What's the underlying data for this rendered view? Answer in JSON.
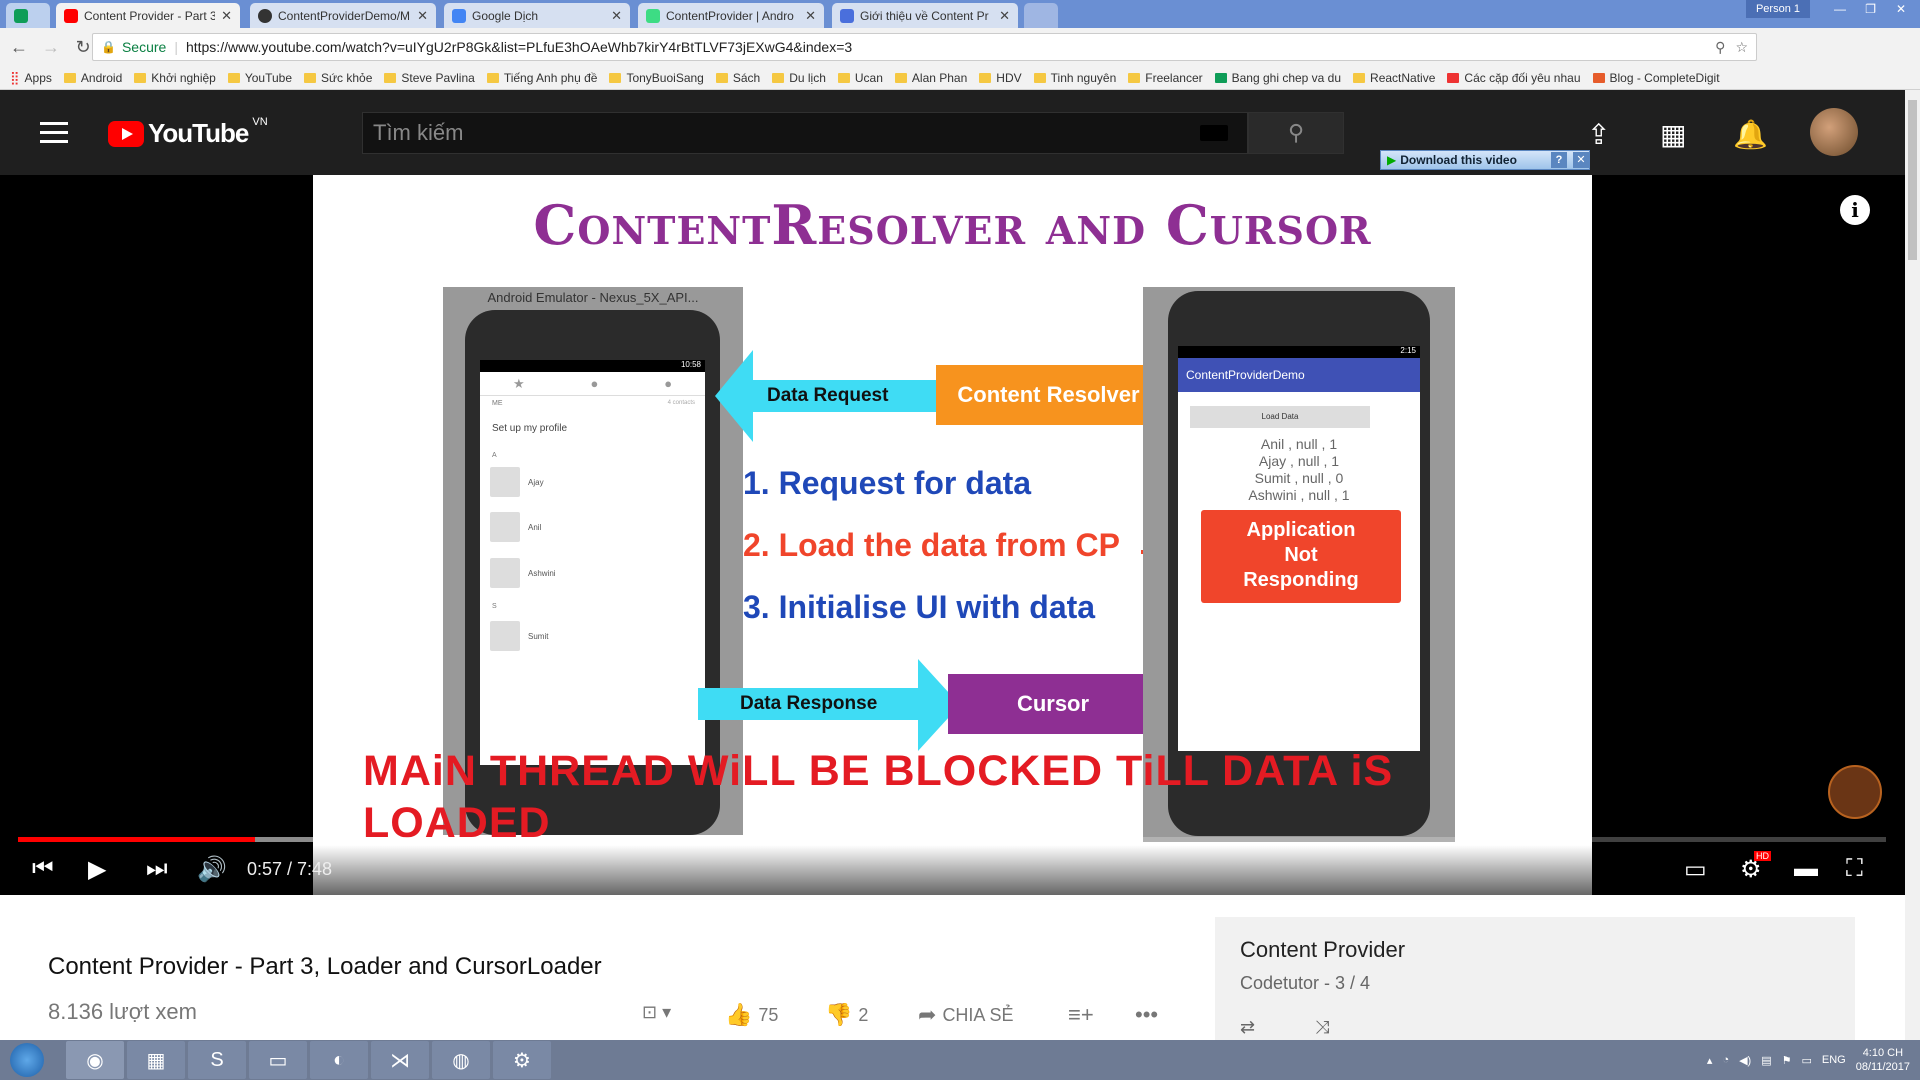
{
  "browser": {
    "tabs": [
      {
        "title": "Content Provider - Part 3",
        "active": true,
        "color": "#ff0000"
      },
      {
        "title": "ContentProviderDemo/M",
        "active": false,
        "color": "#333333"
      },
      {
        "title": "Google Dịch",
        "active": false,
        "color": "#4285f4"
      },
      {
        "title": "ContentProvider | Andro",
        "active": false,
        "color": "#3ddc84"
      },
      {
        "title": "Giới thiệu về Content Pr",
        "active": false,
        "color": "#4a6fdc"
      }
    ],
    "person": "Person 1",
    "secure_label": "Secure",
    "url": "https://www.youtube.com/watch?v=uIYgU2rP8Gk&list=PLfuE3hOAeWhb7kirY4rBtTLVF73jEXwG4&index=3",
    "bookmarks": [
      "Apps",
      "Android",
      "Khởi nghiệp",
      "YouTube",
      "Sức khỏe",
      "Steve Pavlina",
      "Tiếng Anh phụ đề",
      "TonyBuoiSang",
      "Sách",
      "Du lịch",
      "Ucan",
      "Alan Phan",
      "HDV",
      "Tinh nguyên",
      "Freelancer",
      "Bang ghi chep va du",
      "ReactNative",
      "Các cặp đối yêu nhau",
      "Blog - CompleteDigit"
    ]
  },
  "youtube": {
    "country_code": "VN",
    "search_placeholder": "Tìm kiếm",
    "download_label": "Download this video"
  },
  "slide": {
    "title": "ContentResolver and Cursor",
    "emulator_title": "Android Emulator - Nexus_5X_API...",
    "left_phone": {
      "status_time": "10:58",
      "me_label": "ME",
      "contacts_count": "4 contacts",
      "setup": "Set up my profile",
      "section_a": "A",
      "section_s": "S",
      "contacts": [
        "Ajay",
        "Anil",
        "Ashwini",
        "Sumit"
      ]
    },
    "data_request": "Data Request",
    "content_resolver": "Content Resolver",
    "steps": [
      "1. Request for data",
      "2. Load the data from CP",
      "3. Initialise UI with data"
    ],
    "data_response": "Data Response",
    "cursor": "Cursor",
    "right_phone": {
      "status_time": "2:15",
      "app_title": "ContentProviderDemo",
      "load_button": "Load Data",
      "rows": [
        "Anil , null , 1",
        "Ajay , null , 1",
        "Sumit , null , 0",
        "Ashwini , null , 1"
      ]
    },
    "anr": [
      "Application",
      "Not",
      "Responding"
    ],
    "caption": "MAiN THREAD WiLL BE BLOCKED TiLL DATA iS LOADED"
  },
  "player": {
    "time": "0:57 / 7:48",
    "progress_fraction": 0.127,
    "buffered_fraction": 0.44,
    "hd_badge": "HD"
  },
  "video": {
    "title": "Content Provider - Part 3, Loader and CursorLoader",
    "views": "8.136 lượt xem",
    "likes": "75",
    "dislikes": "2",
    "share": "CHIA SẺ"
  },
  "playlist": {
    "title": "Content Provider",
    "subtitle": "Codetutor - 3 / 4"
  },
  "taskbar": {
    "lang": "ENG",
    "time": "4:10 CH",
    "date": "08/11/2017"
  }
}
